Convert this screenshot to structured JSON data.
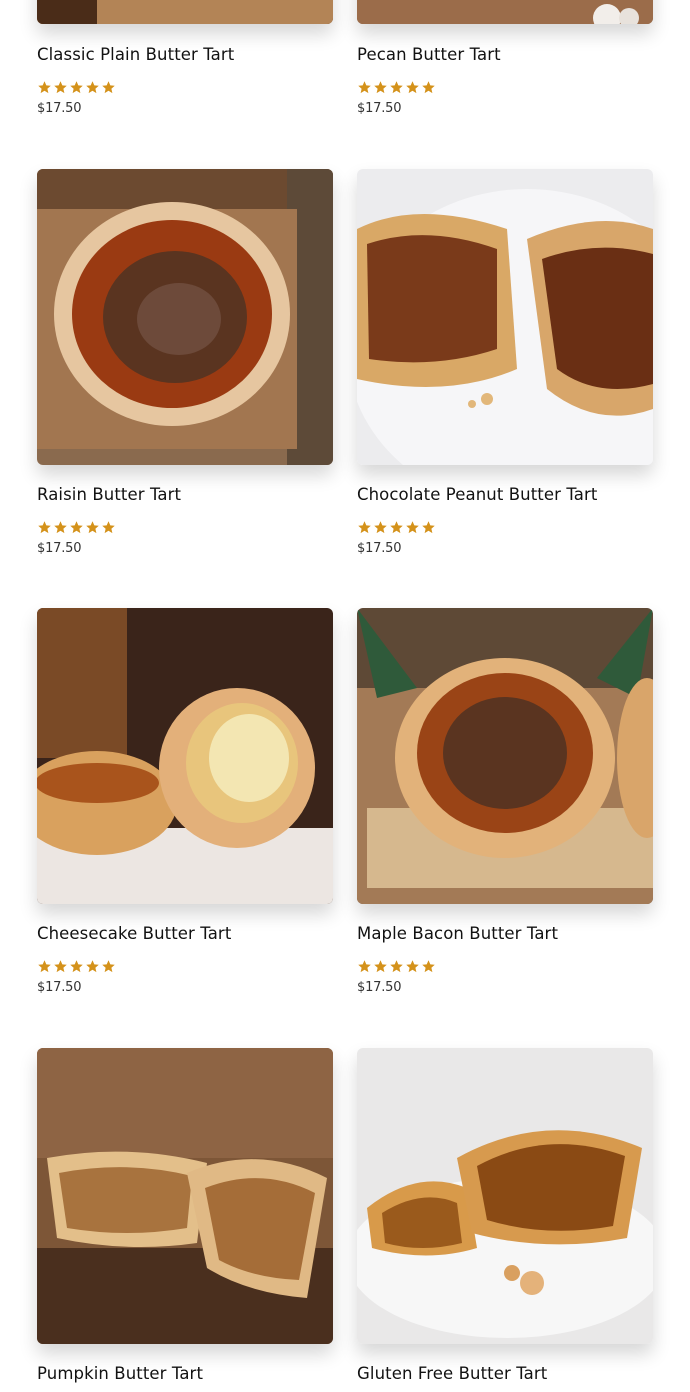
{
  "colors": {
    "star": "#d4921b",
    "text": "#121212",
    "price": "#333333"
  },
  "products": [
    {
      "title": "Classic Plain Butter Tart",
      "rating": 5,
      "price": "$17.50",
      "image": "plain-tart-photo"
    },
    {
      "title": "Pecan Butter Tart",
      "rating": 5,
      "price": "$17.50",
      "image": "pecan-tart-photo"
    },
    {
      "title": "Raisin Butter Tart",
      "rating": 5,
      "price": "$17.50",
      "image": "raisin-tart-photo"
    },
    {
      "title": "Chocolate Peanut Butter Tart",
      "rating": 5,
      "price": "$17.50",
      "image": "chocolate-peanut-tart-photo"
    },
    {
      "title": "Cheesecake Butter Tart",
      "rating": 5,
      "price": "$17.50",
      "image": "cheesecake-tart-photo"
    },
    {
      "title": "Maple Bacon Butter Tart",
      "rating": 5,
      "price": "$17.50",
      "image": "maple-bacon-tart-photo"
    },
    {
      "title": "Pumpkin Butter Tart",
      "image": "pumpkin-tart-photo"
    },
    {
      "title": "Gluten Free Butter Tart",
      "image": "gluten-free-tart-photo"
    }
  ]
}
